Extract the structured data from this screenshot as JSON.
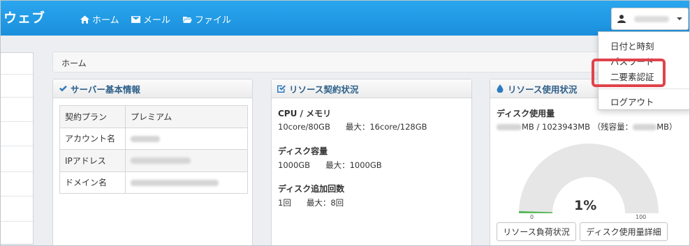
{
  "navbar": {
    "brand": "ウェブ",
    "links": [
      "ホーム",
      "メール",
      "ファイル"
    ]
  },
  "breadcrumb": "ホーム",
  "server_panel": {
    "title": "サーバー基本情報",
    "rows": [
      {
        "label": "契約プラン",
        "value": "プレミアム"
      },
      {
        "label": "アカウント名",
        "value": ""
      },
      {
        "label": "IPアドレス",
        "value": ""
      },
      {
        "label": "ドメイン名",
        "value": ""
      }
    ]
  },
  "contract_panel": {
    "title": "リソース契約状況",
    "cpu_label": "CPU / メモリ",
    "cpu_current": "10core/80GB",
    "cpu_max": "最大：16core/128GB",
    "disk_label": "ディスク容量",
    "disk_current": "1000GB",
    "disk_max": "最大：1000GB",
    "add_label": "ディスク追加回数",
    "add_current": "1回",
    "add_max": "最大：8回"
  },
  "usage_panel": {
    "title": "リソース使用状況",
    "disk_usage_label": "ディスク使用量",
    "usage_mid": "MB / 1023943MB （残容量：",
    "usage_end": "MB）",
    "gauge_percent": "1%",
    "gauge_value": 1,
    "gauge_min": "0",
    "gauge_max": "100",
    "btn_load": "リソース負荷状況",
    "btn_detail": "ディスク使用量詳細"
  },
  "dropdown": {
    "items": [
      "日付と時刻",
      "パスワード",
      "二要素認証",
      "ログアウト"
    ]
  },
  "colors": {
    "navbar": "#1a8fdc",
    "highlight": "#e0434b",
    "gauge_fill": "#5cb85c",
    "gauge_track": "#e6e6e6"
  }
}
